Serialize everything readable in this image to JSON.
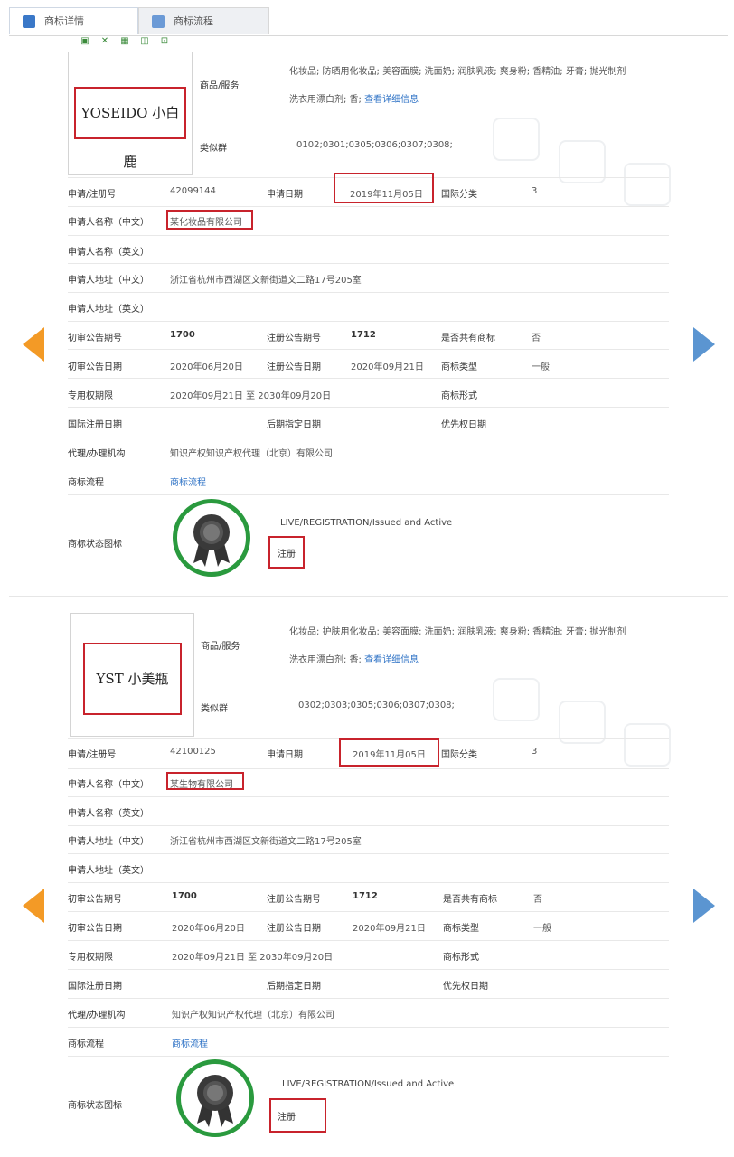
{
  "tabs": [
    {
      "label": "商标详情"
    },
    {
      "label": "商标流程"
    }
  ],
  "labels": {
    "goods_services": "商品/服务",
    "similar_group": "类似群",
    "reg_no": "申请/注册号",
    "app_date": "申请日期",
    "intl_class": "国际分类",
    "applicant_cn": "申请人名称（中文）",
    "applicant_en": "申请人名称（英文）",
    "address_cn": "申请人地址（中文）",
    "address_en": "申请人地址（英文）",
    "prelim_issue": "初审公告期号",
    "reg_issue": "注册公告期号",
    "shared": "是否共有商标",
    "prelim_date": "初审公告日期",
    "reg_date": "注册公告日期",
    "mark_type": "商标类型",
    "exclusive_period": "专用权期限",
    "mark_form": "商标形式",
    "intl_reg_date": "国际注册日期",
    "later_date": "后期指定日期",
    "priority_date": "优先权日期",
    "agent": "代理/办理机构",
    "process": "商标流程",
    "status_icon": "商标状态图标"
  },
  "records": [
    {
      "mark_text": "YOSEIDO 小白鹿",
      "goods_line1": "化妆品; 防晒用化妆品; 美容面膜; 洗面奶; 润肤乳液; 爽身粉; 香精油; 牙膏; 抛光制剂",
      "goods_line2": "洗衣用漂白剂; 香; ",
      "goods_more": "查看详细信息",
      "similar_groups": "0102;0301;0305;0306;0307;0308;",
      "reg_no": "42099144",
      "app_date": "2019年11月05日",
      "intl_class": "3",
      "applicant_cn": "某化妆品有限公司",
      "applicant_en": "",
      "address_cn": "浙江省杭州市西湖区文新街道文二路17号205室",
      "address_en": "",
      "prelim_issue": "1700",
      "reg_issue": "1712",
      "shared": "否",
      "prelim_date": "2020年06月20日",
      "reg_date": "2020年09月21日",
      "mark_type": "一般",
      "exclusive_period": "2020年09月21日 至 2030年09月20日",
      "mark_form": "",
      "intl_reg_date": "",
      "later_date": "",
      "priority_date": "",
      "agent": "知识产权知识产权代理（北京）有限公司",
      "process": "商标流程",
      "status_en": "LIVE/REGISTRATION/Issued and Active",
      "status_cn": "注册"
    },
    {
      "mark_text": "YST 小美瓶",
      "goods_line1": "化妆品; 护肤用化妆品; 美容面膜; 洗面奶; 润肤乳液; 爽身粉; 香精油; 牙膏; 抛光制剂",
      "goods_line2": "洗衣用漂白剂; 香; ",
      "goods_more": "查看详细信息",
      "similar_groups": "0302;0303;0305;0306;0307;0308;",
      "reg_no": "42100125",
      "app_date": "2019年11月05日",
      "intl_class": "3",
      "applicant_cn": "某生物有限公司",
      "applicant_en": "",
      "address_cn": "浙江省杭州市西湖区文新街道文二路17号205室",
      "address_en": "",
      "prelim_issue": "1700",
      "reg_issue": "1712",
      "shared": "否",
      "prelim_date": "2020年06月20日",
      "reg_date": "2020年09月21日",
      "mark_type": "一般",
      "exclusive_period": "2020年09月21日 至 2030年09月20日",
      "mark_form": "",
      "intl_reg_date": "",
      "later_date": "",
      "priority_date": "",
      "agent": "知识产权知识产权代理（北京）有限公司",
      "process": "商标流程",
      "status_en": "LIVE/REGISTRATION/Issued and Active",
      "status_cn": "注册"
    }
  ],
  "colors": {
    "highlight": "#c8232c",
    "link": "#2f73c6",
    "badge_ring": "#2a9a3e",
    "prev_arrow": "#f39a26",
    "next_arrow": "#5b95d1"
  }
}
